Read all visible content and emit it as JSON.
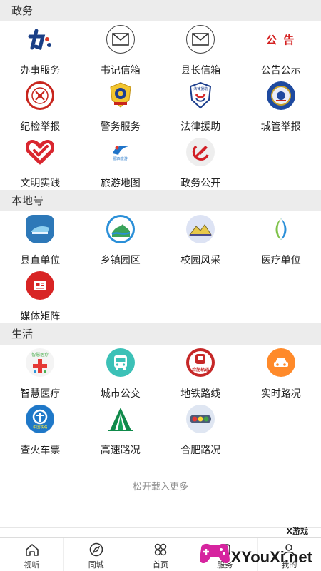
{
  "sections": [
    {
      "title": "政务",
      "items": [
        {
          "label": "办事服务",
          "icon": "ban-logo-icon"
        },
        {
          "label": "书记信箱",
          "icon": "mail-icon"
        },
        {
          "label": "县长信箱",
          "icon": "mail-icon"
        },
        {
          "label": "公告公示",
          "icon": "announcement-icon",
          "icon_text": "公 告"
        },
        {
          "label": "纪检举报",
          "icon": "discipline-emblem-icon"
        },
        {
          "label": "警务服务",
          "icon": "police-badge-icon"
        },
        {
          "label": "法律援助",
          "icon": "legal-aid-shield-icon",
          "icon_text": "法律援助"
        },
        {
          "label": "城管举报",
          "icon": "city-management-badge-icon"
        },
        {
          "label": "文明实践",
          "icon": "heart-logo-icon"
        },
        {
          "label": "旅游地图",
          "icon": "tourism-logo-icon",
          "icon_text": "肥西旅游"
        },
        {
          "label": "政务公开",
          "icon": "party-emblem-icon"
        }
      ]
    },
    {
      "title": "本地号",
      "items": [
        {
          "label": "县直单位",
          "icon": "county-unit-icon"
        },
        {
          "label": "乡镇园区",
          "icon": "town-park-icon"
        },
        {
          "label": "校园风采",
          "icon": "campus-icon"
        },
        {
          "label": "医疗单位",
          "icon": "medical-unit-icon"
        },
        {
          "label": "媒体矩阵",
          "icon": "newspaper-icon"
        }
      ]
    },
    {
      "title": "生活",
      "items": [
        {
          "label": "智慧医疗",
          "icon": "smart-medical-icon",
          "icon_text": "智慧医疗"
        },
        {
          "label": "城市公交",
          "icon": "bus-icon"
        },
        {
          "label": "地铁路线",
          "icon": "metro-icon",
          "icon_text": "合肥轨道"
        },
        {
          "label": "实时路况",
          "icon": "car-icon"
        },
        {
          "label": "查火车票",
          "icon": "railway-logo-icon",
          "icon_text": "中国铁路"
        },
        {
          "label": "高速路况",
          "icon": "highway-icon"
        },
        {
          "label": "合肥路况",
          "icon": "traffic-light-icon"
        }
      ]
    }
  ],
  "load_more": "松开载入更多",
  "tabbar": [
    {
      "label": "视听",
      "icon": "home-icon"
    },
    {
      "label": "同城",
      "icon": "compass-icon"
    },
    {
      "label": "首页",
      "icon": "grid-icon"
    },
    {
      "label": "服务",
      "icon": "service-icon"
    },
    {
      "label": "我的",
      "icon": "profile-icon"
    }
  ],
  "watermark": {
    "small": "X游戏",
    "big": "XYouXi.net"
  }
}
